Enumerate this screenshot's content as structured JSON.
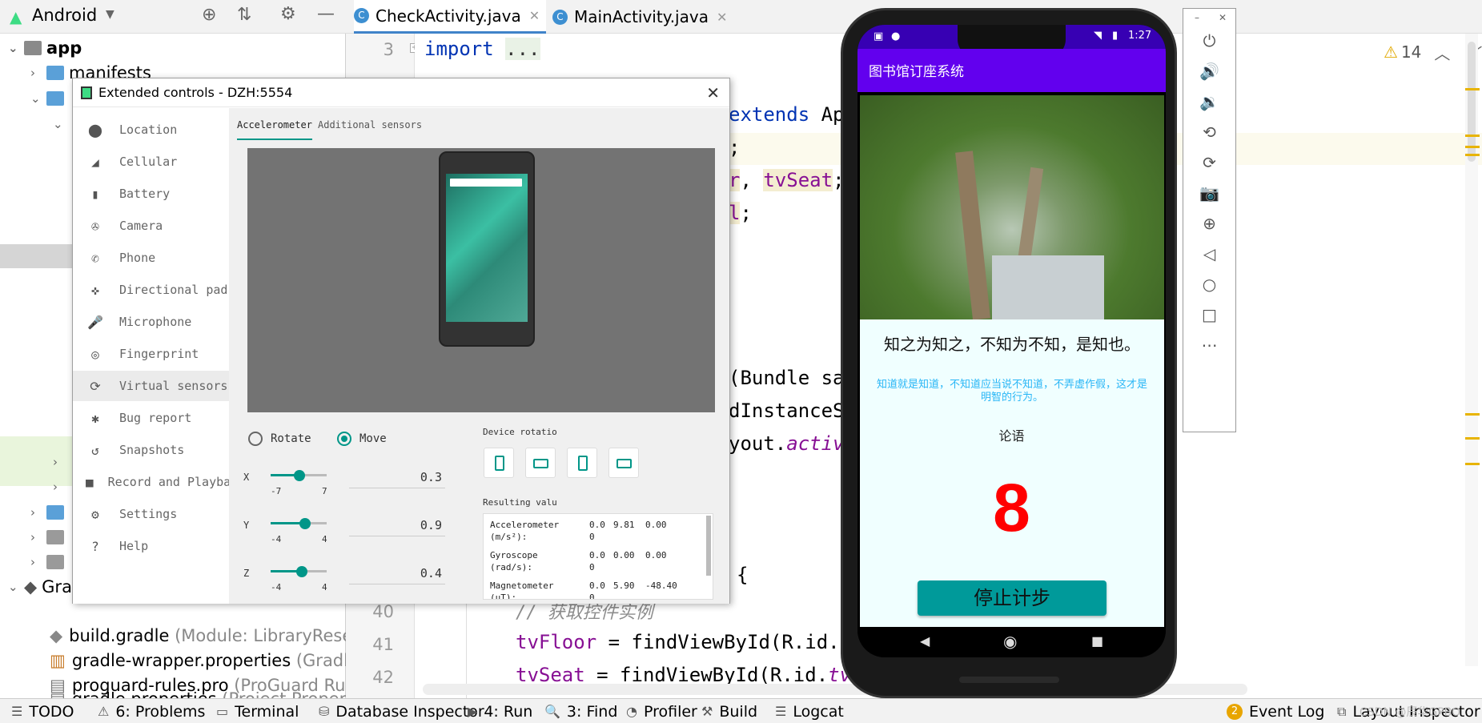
{
  "project_panel": {
    "selector": "Android",
    "tree": [
      {
        "label": "app",
        "detail": ""
      },
      {
        "label": "manifests",
        "detail": ""
      },
      {
        "label": "Gra",
        "detail": ""
      },
      {
        "label": "build.gradle",
        "detail": "(Module: LibraryReser"
      },
      {
        "label": "gradle-wrapper.properties",
        "detail": "(Gradle"
      },
      {
        "label": "proguard-rules.pro",
        "detail": "(ProGuard Rule"
      },
      {
        "label": "gradle.properties",
        "detail": "(Project Properti"
      }
    ]
  },
  "editor": {
    "tabs": [
      {
        "label": "CheckActivity.java"
      },
      {
        "label": "MainActivity.java"
      }
    ],
    "inspection_count": "14",
    "line_numbers": [
      "3",
      "40",
      "41",
      "42"
    ],
    "code": {
      "import_kw": "import",
      "import_rest": "...",
      "extends": "extends",
      "extends_rest": "Ap",
      "semi1": ";",
      "r_char": "r",
      "comma": ",",
      "tvseat": "tvSeat",
      "semi2": ";",
      "l_char": "l",
      "semi3": ";",
      "bundle": "(Bundle sa",
      "instance": "dInstanceS",
      "layout": "yout.",
      "activ": "activ",
      "brace": "{",
      "comment": "// 获取控件实例",
      "tvfloor": "tvFloor",
      "floor_rest": " = findViewById(R.id.",
      "floor_t": "t",
      "tvseat2": "tvSeat",
      "seat_rest": " = findViewById(R.id.",
      "seat_tv": "tv_"
    }
  },
  "extended_controls": {
    "title": "Extended controls - DZH:5554",
    "nav": [
      {
        "label": "Location",
        "icon": "location-pin-icon"
      },
      {
        "label": "Cellular",
        "icon": "signal-icon"
      },
      {
        "label": "Battery",
        "icon": "battery-icon"
      },
      {
        "label": "Camera",
        "icon": "camera-shutter-icon"
      },
      {
        "label": "Phone",
        "icon": "phone-icon"
      },
      {
        "label": "Directional pad",
        "icon": "dpad-icon"
      },
      {
        "label": "Microphone",
        "icon": "microphone-icon"
      },
      {
        "label": "Fingerprint",
        "icon": "fingerprint-icon"
      },
      {
        "label": "Virtual sensors",
        "icon": "rotate-icon"
      },
      {
        "label": "Bug report",
        "icon": "bug-icon"
      },
      {
        "label": "Snapshots",
        "icon": "history-icon"
      },
      {
        "label": "Record and Playback",
        "icon": "video-icon"
      },
      {
        "label": "Settings",
        "icon": "gear-icon"
      },
      {
        "label": "Help",
        "icon": "help-icon"
      }
    ],
    "tabs": [
      "Accelerometer",
      "Additional sensors"
    ],
    "modes": [
      "Rotate",
      "Move"
    ],
    "selected_mode": "Move",
    "sliders": [
      {
        "axis": "X",
        "min": "-7",
        "max": "7",
        "value": "0.3",
        "fraction": 0.52
      },
      {
        "axis": "Y",
        "min": "-4",
        "max": "4",
        "value": "0.9",
        "fraction": 0.61
      },
      {
        "axis": "Z",
        "min": "-4",
        "max": "4",
        "value": "0.4",
        "fraction": 0.55
      }
    ],
    "device_rotation_label": "Device rotatio",
    "resulting_values_label": "Resulting valu",
    "results": [
      {
        "name": "Accelerometer (m/s²):",
        "v1": "0.00",
        "v2": "9.81",
        "v3": "0.00"
      },
      {
        "name": "Gyroscope (rad/s):",
        "v1": "0.00",
        "v2": "0.00",
        "v3": "0.00"
      },
      {
        "name": "Magnetometer (μT):",
        "v1": "0.00",
        "v2": "5.90",
        "v3": "-48.40"
      }
    ]
  },
  "phone": {
    "time": "1:27",
    "app_title": "图书馆订座系统",
    "quote": "知之为知之，不知为不知，是知也。",
    "explanation": "知道就是知道，不知道应当说不知道，不弄虚作假，这才是明智的行为。",
    "source": "论语",
    "countdown": "8",
    "button": "停止计步",
    "accent": "#6200ee",
    "button_color": "#009a9a"
  },
  "emulator_toolbar": {
    "icons": [
      "power-icon",
      "volume-up-icon",
      "volume-down-icon",
      "rotate-left-icon",
      "rotate-right-icon",
      "screenshot-icon",
      "zoom-icon",
      "back-icon",
      "home-icon",
      "overview-icon",
      "more-icon"
    ]
  },
  "status_bar": {
    "items": [
      {
        "label": "TODO"
      },
      {
        "label": "6: Problems"
      },
      {
        "label": "Terminal"
      },
      {
        "label": "Database Inspector"
      },
      {
        "label": "4: Run"
      },
      {
        "label": "3: Find"
      },
      {
        "label": "Profiler"
      },
      {
        "label": "Build"
      },
      {
        "label": "Logcat"
      },
      {
        "label": "Event Log",
        "badge": "2"
      },
      {
        "label": "Layout Inspector"
      }
    ],
    "watermark": "CSDN @辰华GPBO"
  }
}
